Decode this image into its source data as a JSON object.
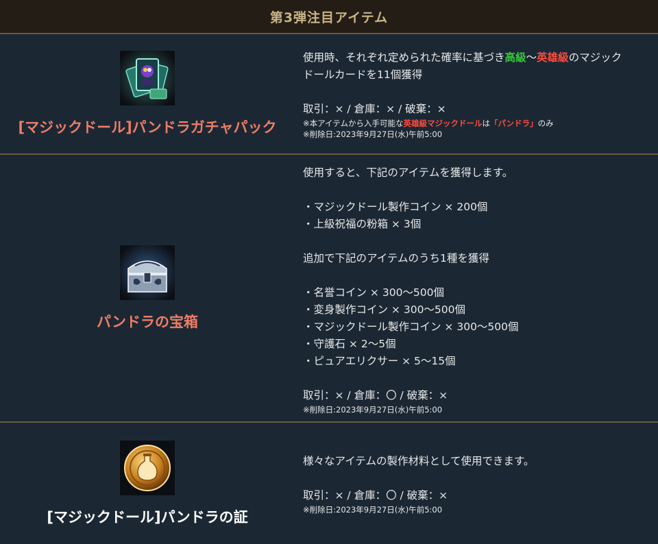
{
  "header": {
    "title": "第3弾注目アイテム"
  },
  "items": [
    {
      "name": "[マジックドール]パンドラガチャパック",
      "icon": "card-pack-icon",
      "desc_a": "使用時、それぞれ定められた確率に基づき",
      "desc_grade1": "高級",
      "desc_tilde": "〜",
      "desc_grade2": "英雄級",
      "desc_b": "のマジック",
      "desc_c": "ドールカードを11個獲得",
      "trade": "取引：× / 倉庫：× / 破棄：×",
      "note1_a": "※本アイテムから入手可能な",
      "note1_b": "英雄級マジックドール",
      "note1_c": "は",
      "note1_d": "「パンドラ」",
      "note1_e": "のみ",
      "delete_note": "※削除日:2023年9月27日(水)午前5:00"
    },
    {
      "name": "パンドラの宝箱",
      "icon": "treasure-chest-icon",
      "desc": "使用すると、下記のアイテムを獲得します。",
      "list1": [
        "・マジックドール製作コイン × 200個",
        "・上級祝福の粉箱 × 3個"
      ],
      "desc2": "追加で下記のアイテムのうち1種を獲得",
      "list2": [
        "・名誉コイン × 300〜500個",
        "・変身製作コイン × 300〜500個",
        "・マジックドール製作コイン × 300〜500個",
        "・守護石 × 2〜5個",
        "・ピュアエリクサー × 5〜15個"
      ],
      "trade": "取引：× / 倉庫：〇 / 破棄：×",
      "delete_note": "※削除日:2023年9月27日(水)午前5:00"
    },
    {
      "name": "[マジックドール]パンドラの証",
      "icon": "gold-coin-icon",
      "desc": "様々なアイテムの製作材料として使用できます。",
      "trade": "取引：× / 倉庫：〇 / 破棄：×",
      "delete_note": "※削除日:2023年9月27日(水)午前5:00"
    }
  ]
}
